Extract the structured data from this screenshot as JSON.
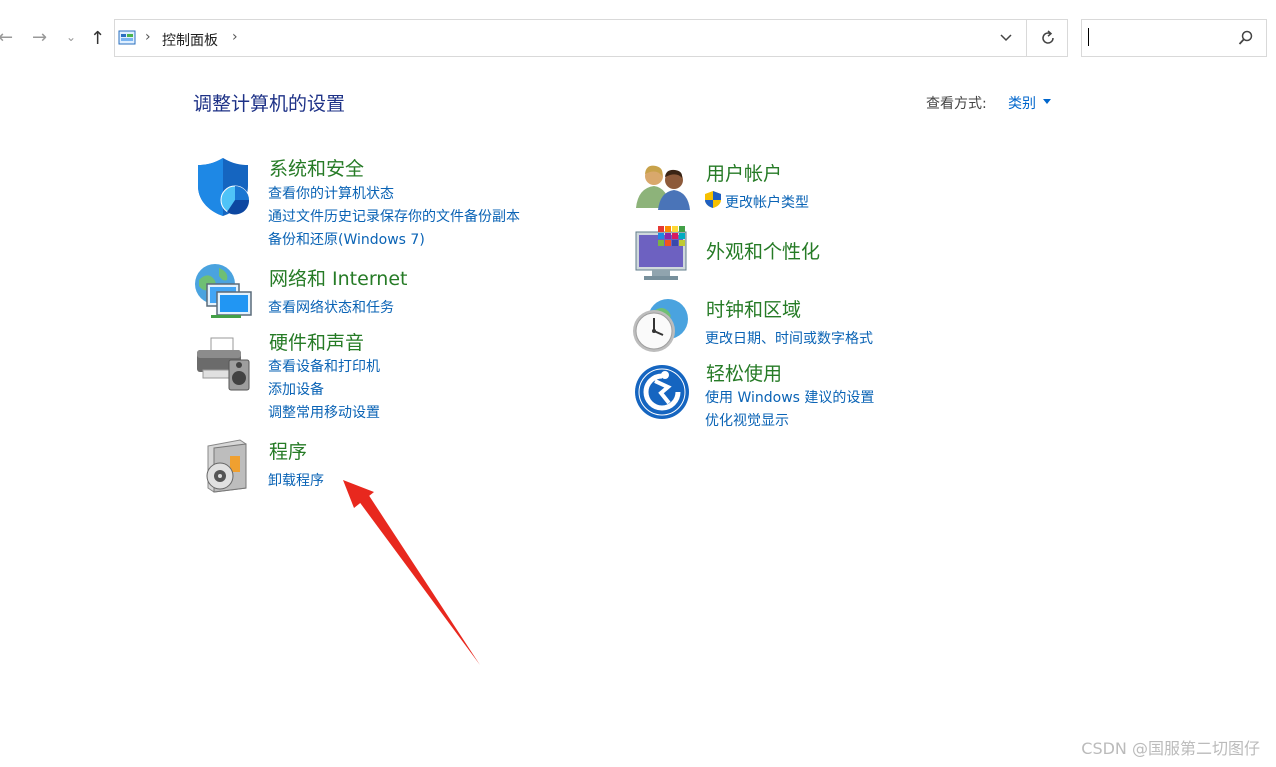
{
  "nav": {
    "back": "←",
    "forward": "→",
    "recent": "⌄",
    "up": "↑",
    "breadcrumb": "控制面板",
    "separator": "›",
    "refresh": "↻",
    "search_placeholder": ""
  },
  "page": {
    "title": "调整计算机的设置",
    "view_label": "查看方式:",
    "view_value": "类别"
  },
  "categories": [
    {
      "title": "系统和安全",
      "icon": "shield-icon",
      "links": [
        "查看你的计算机状态",
        "通过文件历史记录保存你的文件备份副本",
        "备份和还原(Windows 7)"
      ]
    },
    {
      "title": "网络和 Internet",
      "icon": "network-icon",
      "links": [
        "查看网络状态和任务"
      ]
    },
    {
      "title": "硬件和声音",
      "icon": "printer-icon",
      "links": [
        "查看设备和打印机",
        "添加设备",
        "调整常用移动设置"
      ]
    },
    {
      "title": "程序",
      "icon": "programs-icon",
      "links": [
        "卸载程序"
      ]
    },
    {
      "title": "用户帐户",
      "icon": "users-icon",
      "links": [
        "更改帐户类型"
      ]
    },
    {
      "title": "外观和个性化",
      "icon": "monitor-icon",
      "links": []
    },
    {
      "title": "时钟和区域",
      "icon": "clock-globe-icon",
      "links": [
        "更改日期、时间或数字格式"
      ]
    },
    {
      "title": "轻松使用",
      "icon": "ease-of-access-icon",
      "links": [
        "使用 Windows 建议的设置",
        "优化视觉显示"
      ]
    }
  ],
  "watermark": "CSDN @国服第二切图仔",
  "colors": {
    "category_title": "#267b26",
    "link": "#0a63b5",
    "page_title": "#1e3287",
    "annotation_arrow": "#e8281e"
  }
}
